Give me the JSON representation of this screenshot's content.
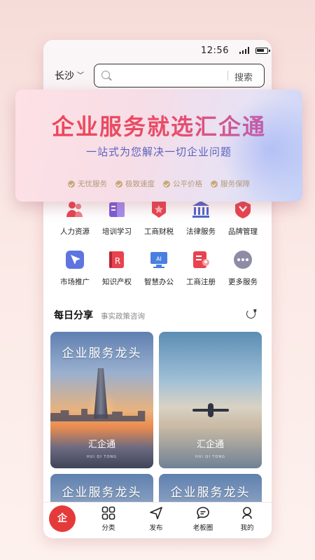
{
  "status_bar": {
    "time": "12:56"
  },
  "header": {
    "city": "长沙",
    "search_placeholder": "",
    "search_button": "搜索"
  },
  "banner": {
    "title": "企业服务就选汇企通",
    "subtitle": "一站式为您解决一切企业问题",
    "tags": [
      "无忧服务",
      "极致速度",
      "公平价格",
      "服务保障"
    ]
  },
  "services": [
    {
      "label": "人力资源",
      "icon": "people-icon",
      "color": "#e8434f"
    },
    {
      "label": "培训学习",
      "icon": "book-icon",
      "color": "#7b5cd6"
    },
    {
      "label": "工商财税",
      "icon": "badge-icon",
      "color": "#e8434f"
    },
    {
      "label": "法律服务",
      "icon": "court-icon",
      "color": "#5065c9"
    },
    {
      "label": "品牌管理",
      "icon": "medal-icon",
      "color": "#e8434f"
    },
    {
      "label": "市场推广",
      "icon": "cursor-icon",
      "color": "#5e74e0"
    },
    {
      "label": "知识产权",
      "icon": "copyright-icon",
      "color": "#e8434f"
    },
    {
      "label": "智慧办公",
      "icon": "ai-monitor-icon",
      "color": "#4a7ee0"
    },
    {
      "label": "工商注册",
      "icon": "register-icon",
      "color": "#e8434f"
    },
    {
      "label": "更多服务",
      "icon": "more-icon",
      "color": "#8e8ba6"
    }
  ],
  "daily_share": {
    "title": "每日分享",
    "subtitle": "事实政策咨询",
    "cards": [
      {
        "title": "企业服务龙头",
        "logo": "汇企通",
        "logo_sub": "HUI QI TONG"
      },
      {
        "title": "",
        "logo": "汇企通",
        "logo_sub": "HUI QI TONG"
      },
      {
        "title": "企业服务龙头"
      },
      {
        "title": "企业服务龙头"
      }
    ]
  },
  "tabbar": {
    "home_glyph": "企",
    "tabs": [
      {
        "label": "分类",
        "icon": "grid-icon"
      },
      {
        "label": "发布",
        "icon": "send-icon"
      },
      {
        "label": "老板圈",
        "icon": "chat-icon"
      },
      {
        "label": "我的",
        "icon": "profile-icon"
      }
    ]
  }
}
